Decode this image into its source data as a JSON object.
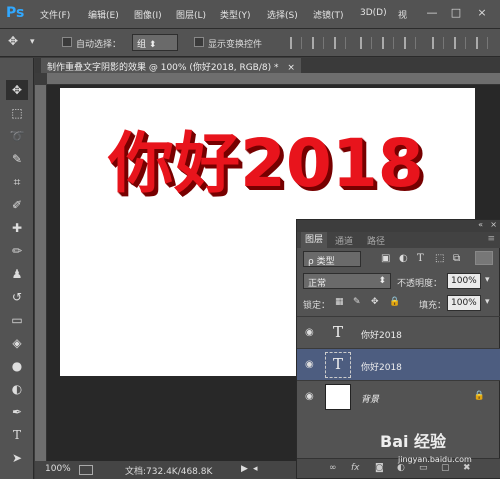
{
  "menubar": {
    "logo": "Ps",
    "items": [
      "文件(F)",
      "编辑(E)",
      "图像(I)",
      "图层(L)",
      "类型(Y)",
      "选择(S)",
      "滤镜(T)",
      "3D(D)",
      "视"
    ],
    "min": "—",
    "max": "□",
    "close": "×"
  },
  "options": {
    "auto_select_label": "自动选择：",
    "auto_select_value": "组",
    "show_transform_label": "显示变换控件"
  },
  "document": {
    "tab_title": "制作重叠文字阴影的效果 @ 100% (你好2018, RGB/8) *",
    "tab_close": "×",
    "headline": "你好2018"
  },
  "status": {
    "zoom": "100%",
    "doc_info": "文档:732.4K/468.8K"
  },
  "layers_panel": {
    "tabs": [
      "图层",
      "通道",
      "路径"
    ],
    "kind_label": "ρ 类型",
    "blend_mode": "正常",
    "opacity_label": "不透明度：",
    "opacity_value": "100%",
    "lock_label": "锁定：",
    "fill_label": "填充：",
    "fill_value": "100%",
    "layers": [
      {
        "name": "你好2018",
        "type": "text",
        "selected": false
      },
      {
        "name": "你好2018",
        "type": "text",
        "selected": true
      },
      {
        "name": "背景",
        "type": "background",
        "selected": false
      }
    ],
    "footer_icons": [
      "link-icon",
      "fx-icon",
      "mask-icon",
      "adjustment-icon",
      "folder-icon",
      "new-layer-icon",
      "trash-icon"
    ]
  },
  "watermark": {
    "brand": "Bai 经验",
    "url": "jingyan.baidu.com"
  }
}
